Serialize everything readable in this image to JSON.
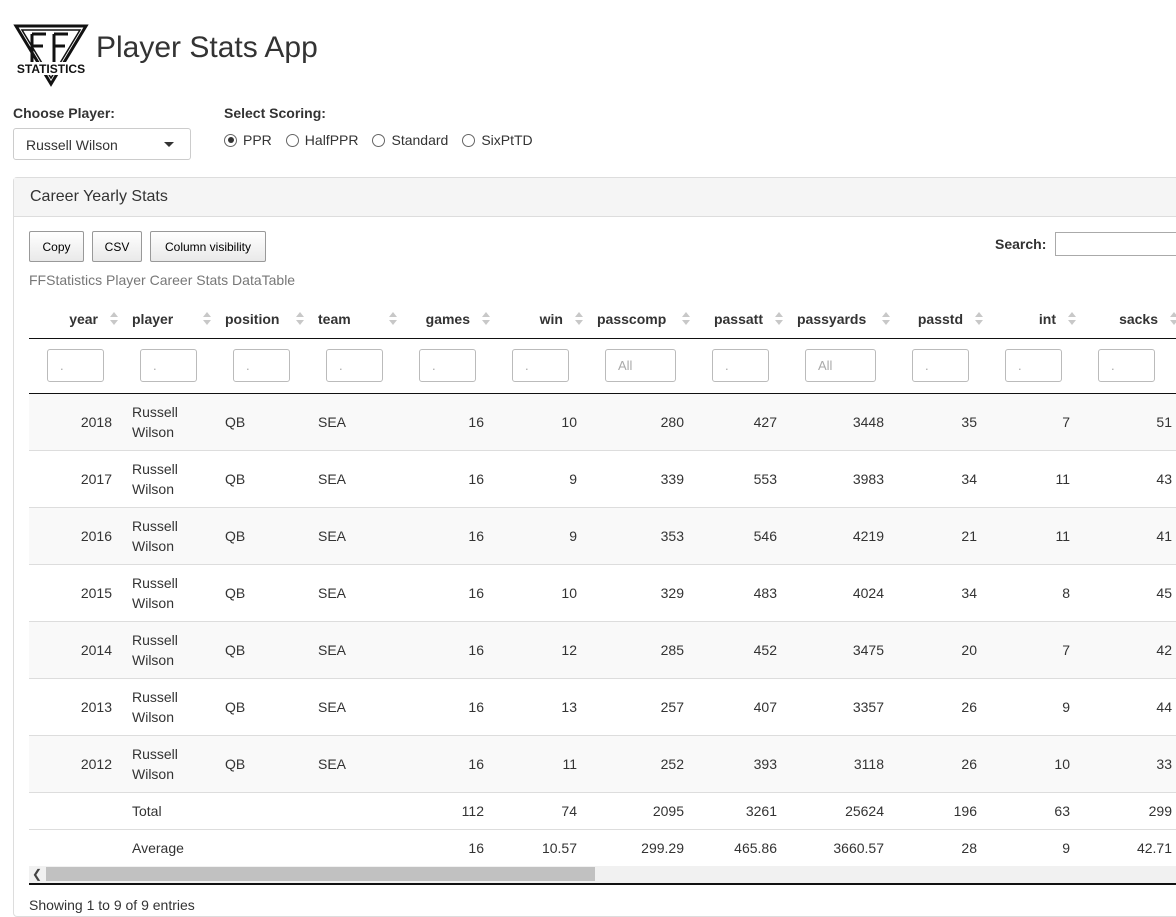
{
  "app": {
    "title": "Player Stats App",
    "logo_text": "STATISTICS"
  },
  "controls": {
    "player_label": "Choose Player:",
    "player_selected": "Russell Wilson",
    "scoring_label": "Select Scoring:",
    "scoring_options": [
      "PPR",
      "HalfPPR",
      "Standard",
      "SixPtTD"
    ],
    "scoring_selected": "PPR"
  },
  "panel": {
    "title": "Career Yearly Stats",
    "buttons": {
      "copy": "Copy",
      "csv": "CSV",
      "colvis": "Column visibility"
    },
    "search_label": "Search:",
    "caption": "FFStatistics Player Career Stats DataTable",
    "info": "Showing 1 to 9 of 9 entries"
  },
  "table": {
    "columns": [
      "year",
      "player",
      "position",
      "team",
      "games",
      "win",
      "passcomp",
      "passatt",
      "passyards",
      "passtd",
      "int",
      "sacks"
    ],
    "filters": [
      ".",
      ".",
      ".",
      ".",
      ".",
      ".",
      "All",
      ".",
      "All",
      ".",
      ".",
      "."
    ],
    "rows": [
      [
        "2018",
        "Russell Wilson",
        "QB",
        "SEA",
        "16",
        "10",
        "280",
        "427",
        "3448",
        "35",
        "7",
        "51"
      ],
      [
        "2017",
        "Russell Wilson",
        "QB",
        "SEA",
        "16",
        "9",
        "339",
        "553",
        "3983",
        "34",
        "11",
        "43"
      ],
      [
        "2016",
        "Russell Wilson",
        "QB",
        "SEA",
        "16",
        "9",
        "353",
        "546",
        "4219",
        "21",
        "11",
        "41"
      ],
      [
        "2015",
        "Russell Wilson",
        "QB",
        "SEA",
        "16",
        "10",
        "329",
        "483",
        "4024",
        "34",
        "8",
        "45"
      ],
      [
        "2014",
        "Russell Wilson",
        "QB",
        "SEA",
        "16",
        "12",
        "285",
        "452",
        "3475",
        "20",
        "7",
        "42"
      ],
      [
        "2013",
        "Russell Wilson",
        "QB",
        "SEA",
        "16",
        "13",
        "257",
        "407",
        "3357",
        "26",
        "9",
        "44"
      ],
      [
        "2012",
        "Russell Wilson",
        "QB",
        "SEA",
        "16",
        "11",
        "252",
        "393",
        "3118",
        "26",
        "10",
        "33"
      ]
    ],
    "footer": [
      [
        "",
        "Total",
        "",
        "",
        "112",
        "74",
        "2095",
        "3261",
        "25624",
        "196",
        "63",
        "299"
      ],
      [
        "",
        "Average",
        "",
        "",
        "16",
        "10.57",
        "299.29",
        "465.86",
        "3660.57",
        "28",
        "9",
        "42.71"
      ]
    ]
  }
}
